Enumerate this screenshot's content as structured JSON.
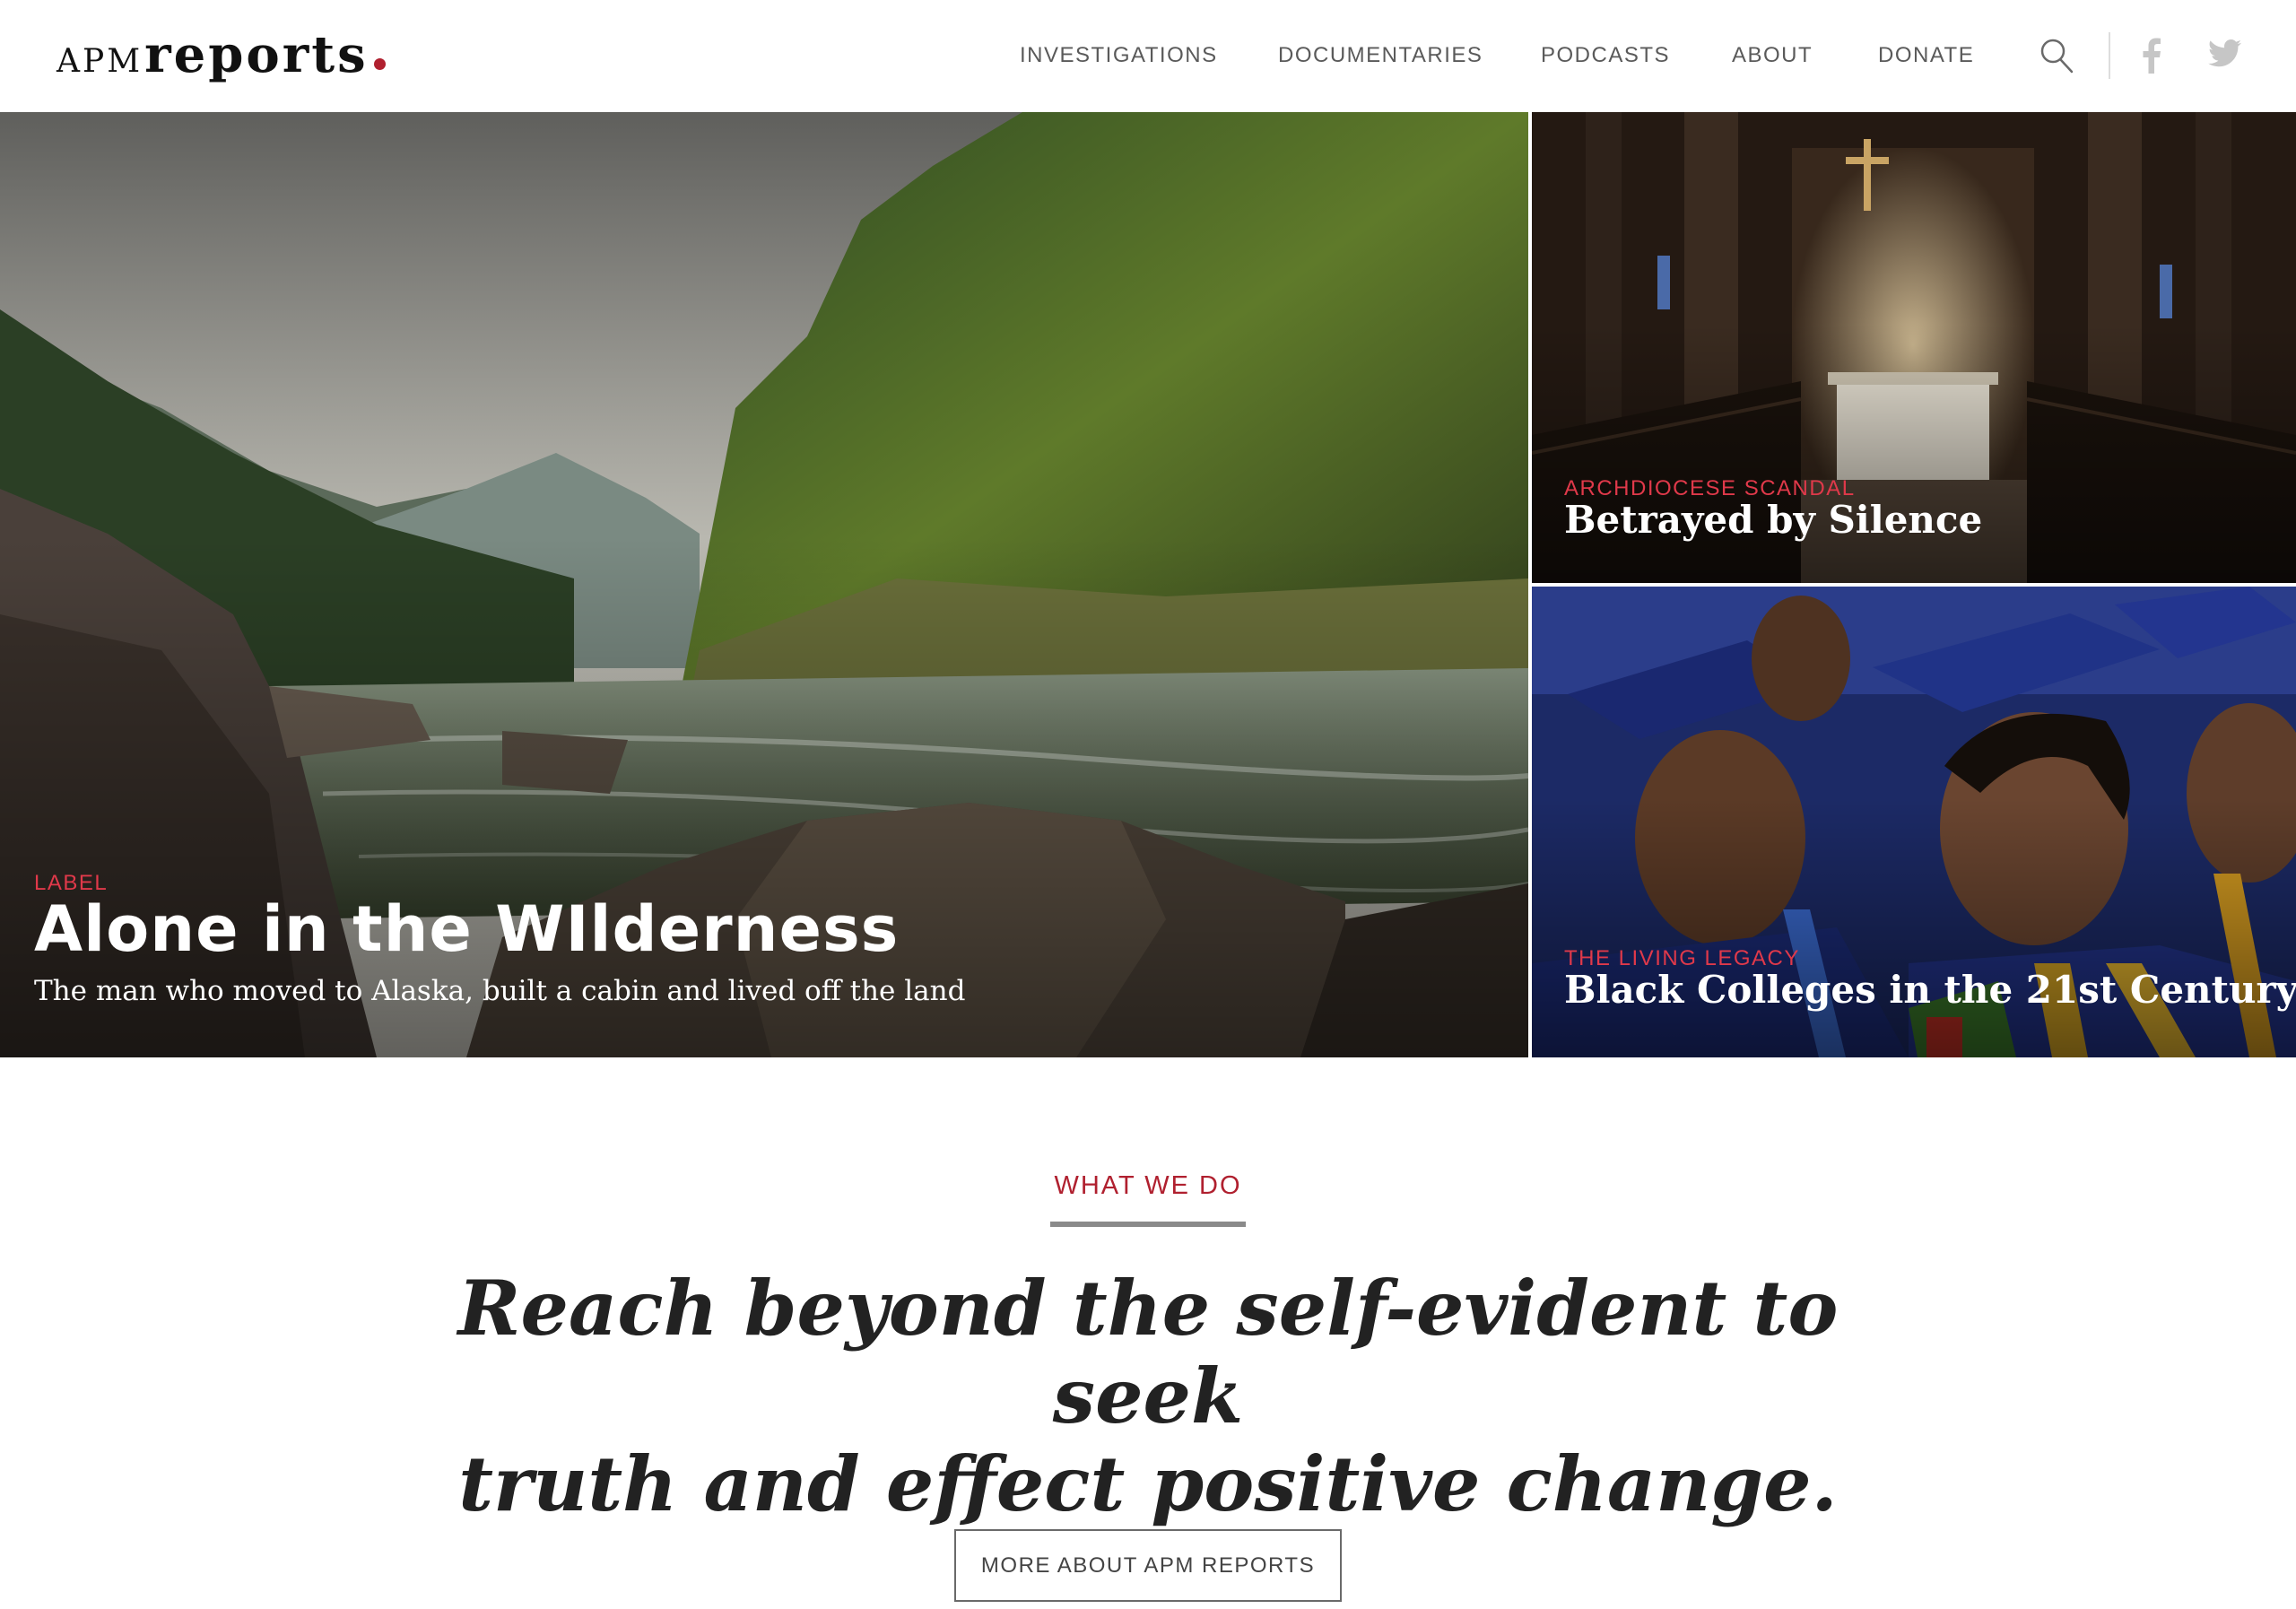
{
  "brand": {
    "prefix": "APM",
    "name": "reports",
    "accent": "#b0202f"
  },
  "nav": {
    "items": [
      {
        "label": "INVESTIGATIONS"
      },
      {
        "label": "DOCUMENTARIES"
      },
      {
        "label": "PODCASTS"
      },
      {
        "label": "ABOUT"
      },
      {
        "label": "DONATE"
      }
    ],
    "icons": [
      "search-icon",
      "facebook-icon",
      "twitter-icon"
    ]
  },
  "hero": {
    "main": {
      "label": "LABEL",
      "title": "Alone in the WIlderness",
      "subtitle": "The man who moved to Alaska, built a cabin and lived off the land"
    },
    "top_right": {
      "label": "ARCHDIOCESE SCANDAL",
      "title": "Betrayed by Silence"
    },
    "bottom_right": {
      "label": "THE LIVING LEGACY",
      "title": "Black Colleges in the 21st Century"
    }
  },
  "what_we_do": {
    "heading": "WHAT WE DO",
    "mission_line1": "Reach beyond the self-evident to seek",
    "mission_line2": "truth and effect positive change.",
    "button_label": "MORE ABOUT APM REPORTS"
  },
  "colors": {
    "label_red": "#e0394a",
    "heading_red": "#b0202f",
    "nav_gray": "#5a5a5a"
  }
}
